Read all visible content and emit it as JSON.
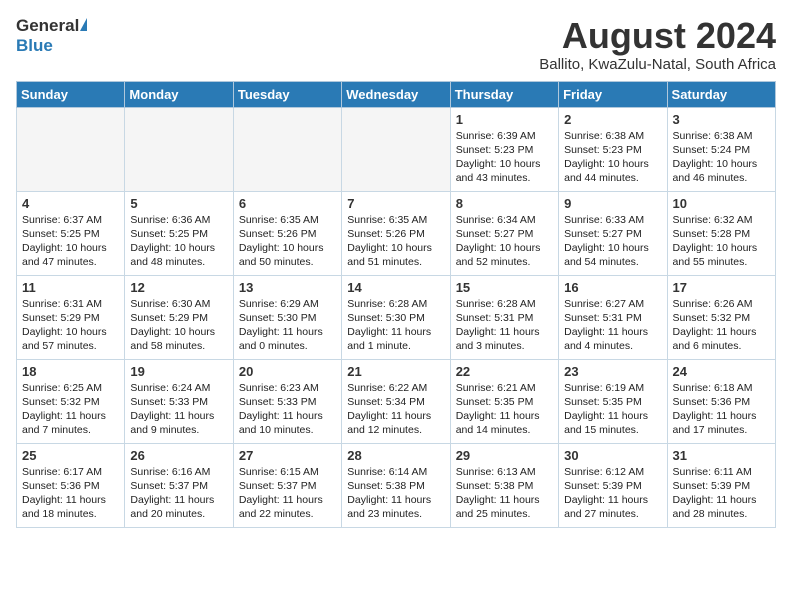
{
  "logo": {
    "general": "General",
    "blue": "Blue"
  },
  "header": {
    "month": "August 2024",
    "location": "Ballito, KwaZulu-Natal, South Africa"
  },
  "weekdays": [
    "Sunday",
    "Monday",
    "Tuesday",
    "Wednesday",
    "Thursday",
    "Friday",
    "Saturday"
  ],
  "weeks": [
    [
      {
        "day": "",
        "info": ""
      },
      {
        "day": "",
        "info": ""
      },
      {
        "day": "",
        "info": ""
      },
      {
        "day": "",
        "info": ""
      },
      {
        "day": "1",
        "info": "Sunrise: 6:39 AM\nSunset: 5:23 PM\nDaylight: 10 hours\nand 43 minutes."
      },
      {
        "day": "2",
        "info": "Sunrise: 6:38 AM\nSunset: 5:23 PM\nDaylight: 10 hours\nand 44 minutes."
      },
      {
        "day": "3",
        "info": "Sunrise: 6:38 AM\nSunset: 5:24 PM\nDaylight: 10 hours\nand 46 minutes."
      }
    ],
    [
      {
        "day": "4",
        "info": "Sunrise: 6:37 AM\nSunset: 5:25 PM\nDaylight: 10 hours\nand 47 minutes."
      },
      {
        "day": "5",
        "info": "Sunrise: 6:36 AM\nSunset: 5:25 PM\nDaylight: 10 hours\nand 48 minutes."
      },
      {
        "day": "6",
        "info": "Sunrise: 6:35 AM\nSunset: 5:26 PM\nDaylight: 10 hours\nand 50 minutes."
      },
      {
        "day": "7",
        "info": "Sunrise: 6:35 AM\nSunset: 5:26 PM\nDaylight: 10 hours\nand 51 minutes."
      },
      {
        "day": "8",
        "info": "Sunrise: 6:34 AM\nSunset: 5:27 PM\nDaylight: 10 hours\nand 52 minutes."
      },
      {
        "day": "9",
        "info": "Sunrise: 6:33 AM\nSunset: 5:27 PM\nDaylight: 10 hours\nand 54 minutes."
      },
      {
        "day": "10",
        "info": "Sunrise: 6:32 AM\nSunset: 5:28 PM\nDaylight: 10 hours\nand 55 minutes."
      }
    ],
    [
      {
        "day": "11",
        "info": "Sunrise: 6:31 AM\nSunset: 5:29 PM\nDaylight: 10 hours\nand 57 minutes."
      },
      {
        "day": "12",
        "info": "Sunrise: 6:30 AM\nSunset: 5:29 PM\nDaylight: 10 hours\nand 58 minutes."
      },
      {
        "day": "13",
        "info": "Sunrise: 6:29 AM\nSunset: 5:30 PM\nDaylight: 11 hours\nand 0 minutes."
      },
      {
        "day": "14",
        "info": "Sunrise: 6:28 AM\nSunset: 5:30 PM\nDaylight: 11 hours\nand 1 minute."
      },
      {
        "day": "15",
        "info": "Sunrise: 6:28 AM\nSunset: 5:31 PM\nDaylight: 11 hours\nand 3 minutes."
      },
      {
        "day": "16",
        "info": "Sunrise: 6:27 AM\nSunset: 5:31 PM\nDaylight: 11 hours\nand 4 minutes."
      },
      {
        "day": "17",
        "info": "Sunrise: 6:26 AM\nSunset: 5:32 PM\nDaylight: 11 hours\nand 6 minutes."
      }
    ],
    [
      {
        "day": "18",
        "info": "Sunrise: 6:25 AM\nSunset: 5:32 PM\nDaylight: 11 hours\nand 7 minutes."
      },
      {
        "day": "19",
        "info": "Sunrise: 6:24 AM\nSunset: 5:33 PM\nDaylight: 11 hours\nand 9 minutes."
      },
      {
        "day": "20",
        "info": "Sunrise: 6:23 AM\nSunset: 5:33 PM\nDaylight: 11 hours\nand 10 minutes."
      },
      {
        "day": "21",
        "info": "Sunrise: 6:22 AM\nSunset: 5:34 PM\nDaylight: 11 hours\nand 12 minutes."
      },
      {
        "day": "22",
        "info": "Sunrise: 6:21 AM\nSunset: 5:35 PM\nDaylight: 11 hours\nand 14 minutes."
      },
      {
        "day": "23",
        "info": "Sunrise: 6:19 AM\nSunset: 5:35 PM\nDaylight: 11 hours\nand 15 minutes."
      },
      {
        "day": "24",
        "info": "Sunrise: 6:18 AM\nSunset: 5:36 PM\nDaylight: 11 hours\nand 17 minutes."
      }
    ],
    [
      {
        "day": "25",
        "info": "Sunrise: 6:17 AM\nSunset: 5:36 PM\nDaylight: 11 hours\nand 18 minutes."
      },
      {
        "day": "26",
        "info": "Sunrise: 6:16 AM\nSunset: 5:37 PM\nDaylight: 11 hours\nand 20 minutes."
      },
      {
        "day": "27",
        "info": "Sunrise: 6:15 AM\nSunset: 5:37 PM\nDaylight: 11 hours\nand 22 minutes."
      },
      {
        "day": "28",
        "info": "Sunrise: 6:14 AM\nSunset: 5:38 PM\nDaylight: 11 hours\nand 23 minutes."
      },
      {
        "day": "29",
        "info": "Sunrise: 6:13 AM\nSunset: 5:38 PM\nDaylight: 11 hours\nand 25 minutes."
      },
      {
        "day": "30",
        "info": "Sunrise: 6:12 AM\nSunset: 5:39 PM\nDaylight: 11 hours\nand 27 minutes."
      },
      {
        "day": "31",
        "info": "Sunrise: 6:11 AM\nSunset: 5:39 PM\nDaylight: 11 hours\nand 28 minutes."
      }
    ]
  ]
}
